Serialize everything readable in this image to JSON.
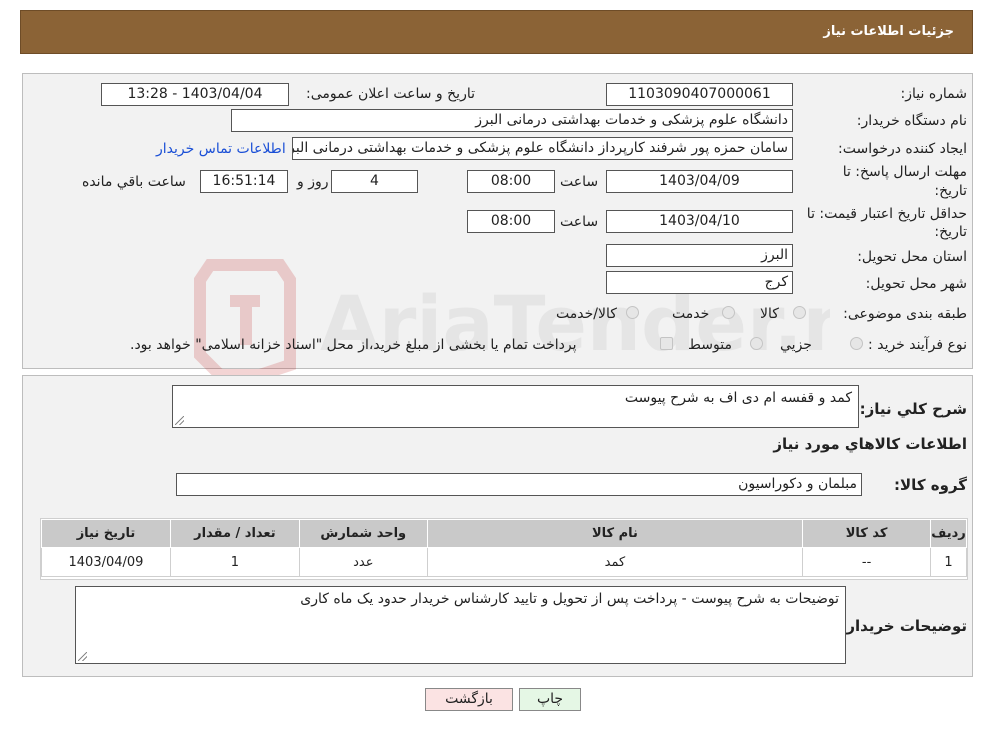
{
  "header": {
    "title": "جزئیات اطلاعات نیاز"
  },
  "form": {
    "need_number": {
      "label": "شماره نیاز:",
      "value": "1103090407000061"
    },
    "announce": {
      "label": "تاریخ و ساعت اعلان عمومی:",
      "value": "1403/04/04 - 13:28"
    },
    "buyer_org": {
      "label": "نام دستگاه خریدار:",
      "value": "دانشگاه علوم پزشکی و خدمات بهداشتی  درمانی البرز"
    },
    "requester": {
      "label": "ایجاد کننده درخواست:",
      "value": "سامان حمزه پور شرفند کارپرداز دانشگاه علوم پزشکی و خدمات بهداشتی  درمانی البرز",
      "contact_link": "اطلاعات تماس خریدار"
    },
    "reply_deadline": {
      "label_line1": "مهلت ارسال پاسخ: تا",
      "label_line2": "تاریخ:",
      "date": "1403/04/09",
      "time_label": "ساعت",
      "time": "08:00",
      "days": "4",
      "days_label": "روز و",
      "remaining": "16:51:14",
      "remaining_label": "ساعت باقي مانده"
    },
    "price_validity": {
      "label_line1": "حداقل تاریخ اعتبار قیمت: تا",
      "label_line2": "تاریخ:",
      "date": "1403/04/10",
      "time_label": "ساعت",
      "time": "08:00"
    },
    "province": {
      "label": "استان محل تحویل:",
      "value": "البرز"
    },
    "city": {
      "label": "شهر محل تحویل:",
      "value": "کرج"
    },
    "category": {
      "label": "طبقه بندی موضوعی:",
      "options": [
        "کالا",
        "خدمت",
        "کالا/خدمت"
      ]
    },
    "process": {
      "label": "نوع فرآیند خرید :",
      "options": [
        "جزیي",
        "متوسط"
      ],
      "note": "پرداخت تمام یا بخشی از مبلغ خرید،از محل \"اسناد خزانه اسلامی\" خواهد بود."
    }
  },
  "details": {
    "summary_label": "شرح کلي نیاز:",
    "summary_value": "کمد و قفسه ام دی اف به شرح پیوست",
    "goods_info_title": "اطلاعات کالاهاي مورد نیاز",
    "goods_group_label": "گروه کالا:",
    "goods_group_value": "مبلمان و دکوراسیون",
    "table": {
      "headers": [
        "ردیف",
        "کد کالا",
        "نام کالا",
        "واحد شمارش",
        "تعداد / مقدار",
        "تاریخ نیاز"
      ],
      "rows": [
        [
          "1",
          "--",
          "کمد",
          "عدد",
          "1",
          "1403/04/09"
        ]
      ]
    },
    "buyer_notes_label": "توضیحات خریدار:",
    "buyer_notes_value": "توضیحات به شرح پیوست - پرداخت پس از تحویل  و تایید کارشناس خریدار حدود یک ماه کاری"
  },
  "buttons": {
    "print": "چاپ",
    "back": "بازگشت"
  },
  "watermark": {
    "text": "AriaTender.neT"
  },
  "colors": {
    "header_bg": "#8b6336",
    "link": "#1a4fd6",
    "back_button_bg": "#fbe3e3",
    "print_button_bg": "#e5f7e5"
  }
}
